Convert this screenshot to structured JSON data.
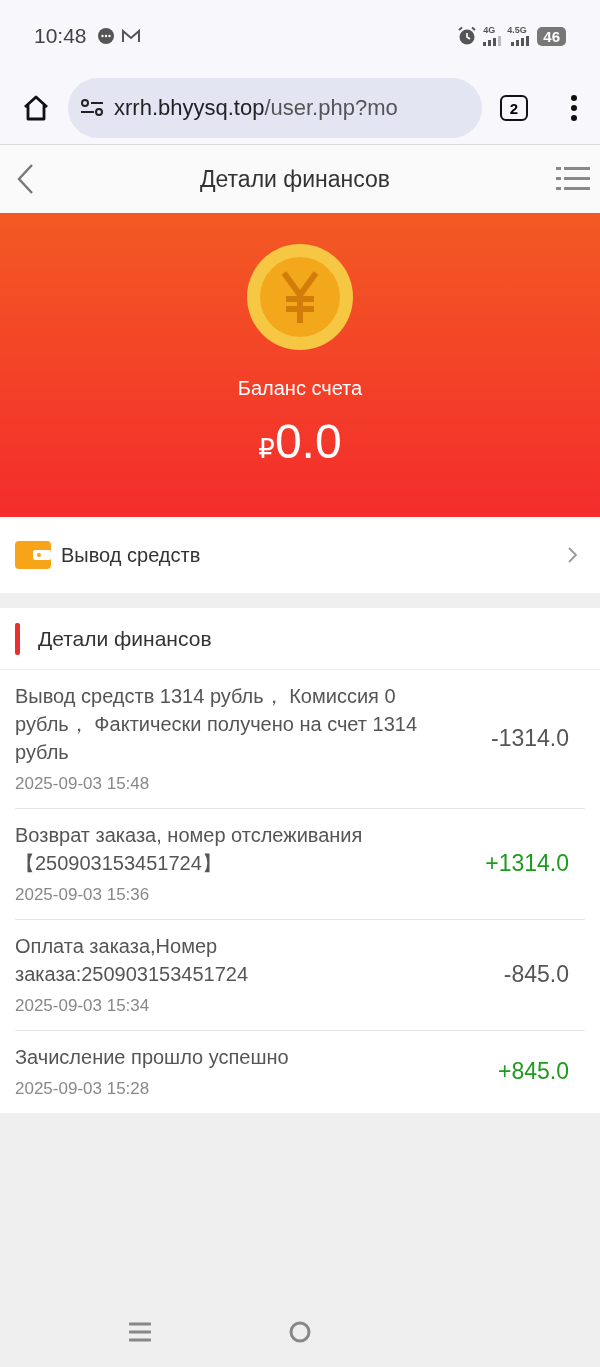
{
  "status_bar": {
    "time": "10:48",
    "network_1": "4G",
    "network_2": "4.5G",
    "battery": "46"
  },
  "browser": {
    "url_host": "xrrh.bhyysq.top",
    "url_path": "/user.php?mo",
    "tab_count": "2"
  },
  "header": {
    "title": "Детали финансов"
  },
  "balance": {
    "label": "Баланс счета",
    "currency": "₽",
    "amount": "0.0"
  },
  "withdraw": {
    "label": "Вывод средств"
  },
  "section": {
    "title": "Детали финансов"
  },
  "transactions": [
    {
      "description": "Вывод средств 1314 рубль，  Комиссия 0 рубль，  Фактически получено на счет 1314 рубль",
      "date": "2025-09-03 15:48",
      "amount": "-1314.0",
      "kind": "debit"
    },
    {
      "description": "Возврат заказа, номер отслеживания 【250903153451724】",
      "date": "2025-09-03 15:36",
      "amount": "+1314.0",
      "kind": "credit"
    },
    {
      "description": "Оплата заказа,Номер заказа:250903153451724",
      "date": "2025-09-03 15:34",
      "amount": "-845.0",
      "kind": "debit"
    },
    {
      "description": "Зачисление прошло успешно",
      "date": "2025-09-03 15:28",
      "amount": "+845.0",
      "kind": "credit"
    }
  ]
}
